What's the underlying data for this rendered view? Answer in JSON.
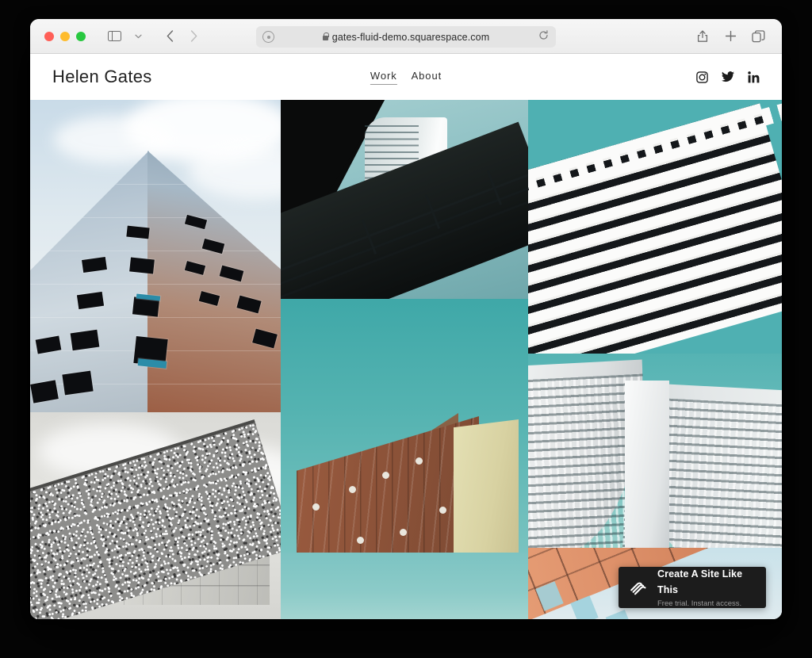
{
  "browser": {
    "window_controls": [
      "close",
      "minimize",
      "zoom"
    ],
    "sidebar_toggle_label": "Show sidebar",
    "tab_overview_label": "Tab Overview",
    "back_label": "Back",
    "forward_label": "Forward",
    "url": "gates-fluid-demo.squarespace.com",
    "secure": true,
    "reload_label": "Reload",
    "share_label": "Share",
    "new_tab_label": "New Tab"
  },
  "site": {
    "brand": "Helen Gates",
    "nav": [
      {
        "label": "Work",
        "active": true
      },
      {
        "label": "About",
        "active": false
      }
    ],
    "social": [
      {
        "name": "instagram",
        "label": "Instagram"
      },
      {
        "name": "twitter",
        "label": "Twitter"
      },
      {
        "name": "linkedin",
        "label": "LinkedIn"
      }
    ]
  },
  "gallery": {
    "columns": [
      {
        "tiles": [
          {
            "alt": "Glass skyscraper seen from below against pale blue sky"
          },
          {
            "alt": "Black and white brutalist building behind gravel roof"
          }
        ]
      },
      {
        "tiles": [
          {
            "alt": "Dark overpass railing with white curved tower and teal sky"
          },
          {
            "alt": "Brick apartment block with cream end wall under teal sky"
          },
          {
            "alt": "Teal sky"
          }
        ]
      },
      {
        "tiles": [
          {
            "alt": "White diagonal louvre fins against teal sky"
          },
          {
            "alt": "Curved white modernist tower with window grid"
          },
          {
            "alt": "Salmon coloured building facade with pale blue sky"
          }
        ]
      }
    ]
  },
  "banner": {
    "title": "Create A Site Like This",
    "subtitle": "Free trial. Instant access.",
    "logo": "squarespace-logo"
  },
  "colors": {
    "teal": "#4fb0b2",
    "banner_bg": "#1c1c1c",
    "toolbar_bg": "#ececec",
    "text": "#222222"
  }
}
